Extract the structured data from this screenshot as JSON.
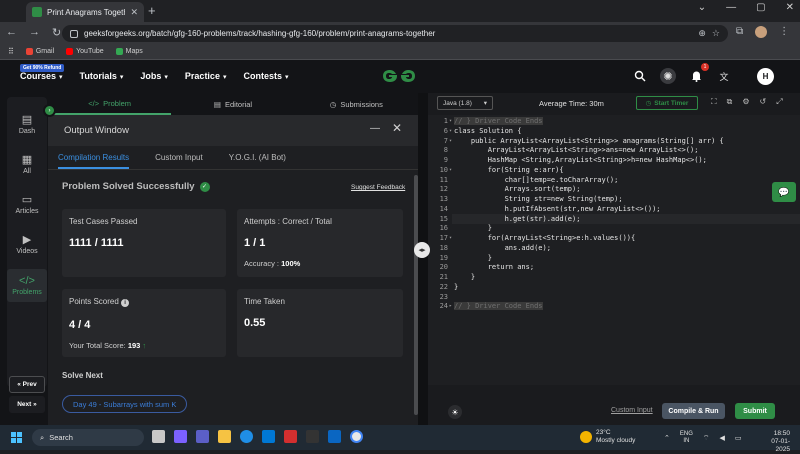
{
  "browser": {
    "tab_title": "Print Anagrams Together | Prac",
    "tab_close": "✕",
    "new_tab": "+",
    "window_controls": [
      "⌄",
      "—",
      "▢",
      "✕"
    ],
    "url": "geeksforgeeks.org/batch/gfg-160-problems/track/hashing-gfg-160/problem/print-anagrams-together",
    "bookmarks": [
      {
        "label": "Gmail",
        "color": "#ea4335"
      },
      {
        "label": "YouTube",
        "color": "#ff0000"
      },
      {
        "label": "Maps",
        "color": "#34a853"
      }
    ]
  },
  "header": {
    "promo": "Get 90% Refund",
    "nav": [
      "Courses",
      "Tutorials",
      "Jobs",
      "Practice",
      "Contests"
    ],
    "logo": "GG",
    "notification_count": "1",
    "user_initial": "H"
  },
  "sidebar": {
    "items": [
      {
        "label": "Dash",
        "icon": "▤"
      },
      {
        "label": "All",
        "icon": "▦"
      },
      {
        "label": "Articles",
        "icon": "▭"
      },
      {
        "label": "Videos",
        "icon": "▶"
      },
      {
        "label": "Problems",
        "icon": "</>"
      }
    ],
    "prev": "« Prev",
    "next": "Next »"
  },
  "problem_tabs": [
    {
      "label": "Problem",
      "icon": "</>"
    },
    {
      "label": "Editorial",
      "icon": "▤"
    },
    {
      "label": "Submissions",
      "icon": "◷"
    }
  ],
  "output": {
    "title": "Output Window",
    "minimize": "—",
    "close": "✕",
    "tabs": [
      "Compilation Results",
      "Custom Input",
      "Y.O.G.I. (AI Bot)"
    ],
    "status": "Problem Solved Successfully",
    "suggest": "Suggest Feedback",
    "test_cases_label": "Test Cases Passed",
    "test_cases_value": "1111 / 1111",
    "attempts_label": "Attempts : Correct / Total",
    "attempts_value": "1 / 1",
    "accuracy_label": "Accuracy :",
    "accuracy_value": "100%",
    "points_label": "Points Scored",
    "points_value": "4 / 4",
    "total_score_label": "Your Total Score:",
    "total_score_value": "193",
    "time_label": "Time Taken",
    "time_value": "0.55",
    "solve_next": "Solve Next",
    "next_problem": "Day 49 - Subarrays with sum K"
  },
  "editor": {
    "language": "Java (1.8)",
    "avg_time": "Average Time: 30m",
    "start_timer": "Start Timer",
    "lines": [
      {
        "n": "1",
        "text": "// } Driver Code Ends",
        "comment": true,
        "fold": "▾"
      },
      {
        "n": "6",
        "text": "class Solution {",
        "fold": "▾"
      },
      {
        "n": "7",
        "text": "    public ArrayList<ArrayList<String>> anagrams(String[] arr) {",
        "fold": "▾"
      },
      {
        "n": "8",
        "text": "        ArrayList<ArrayList<String>>ans=new ArrayList<>();"
      },
      {
        "n": "9",
        "text": "        HashMap <String,ArrayList<String>>h=new HashMap<>();"
      },
      {
        "n": "10",
        "text": "        for(String e:arr){",
        "fold": "▾"
      },
      {
        "n": "11",
        "text": "            char[]temp=e.toCharArray();"
      },
      {
        "n": "12",
        "text": "            Arrays.sort(temp);"
      },
      {
        "n": "13",
        "text": "            String str=new String(temp);"
      },
      {
        "n": "14",
        "text": "            h.putIfAbsent(str,new ArrayList<>());"
      },
      {
        "n": "15",
        "text": "            h.get(str).add(e);",
        "current": true
      },
      {
        "n": "16",
        "text": "        }"
      },
      {
        "n": "17",
        "text": "        for(ArrayList<String>e:h.values()){",
        "fold": "▾"
      },
      {
        "n": "18",
        "text": "            ans.add(e);"
      },
      {
        "n": "19",
        "text": "        }"
      },
      {
        "n": "20",
        "text": "        return ans;"
      },
      {
        "n": "21",
        "text": "    }"
      },
      {
        "n": "22",
        "text": "}"
      },
      {
        "n": "23",
        "text": ""
      },
      {
        "n": "24",
        "text": "// } Driver Code Ends",
        "comment": true,
        "fold": "▸"
      }
    ],
    "custom_input": "Custom Input",
    "compile_run": "Compile & Run",
    "submit": "Submit"
  },
  "taskbar": {
    "search": "Search",
    "weather_temp": "23°C",
    "weather_text": "Mostly cloudy",
    "lang1": "ENG",
    "lang2": "IN",
    "time": "18:50",
    "date": "07-01-2025"
  },
  "colors": {
    "brand_green": "#2f8d46",
    "link_blue": "#3b8fe0"
  }
}
